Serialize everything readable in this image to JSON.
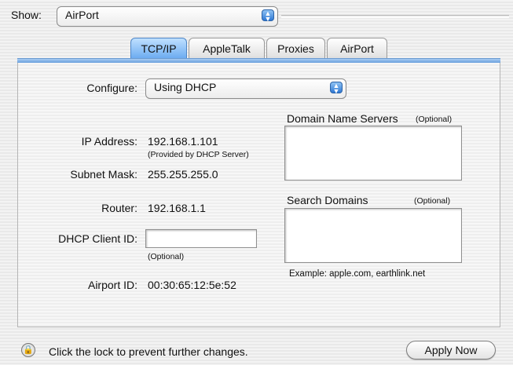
{
  "show": {
    "label": "Show:",
    "value": "AirPort"
  },
  "tabs": [
    {
      "label": "TCP/IP",
      "selected": true
    },
    {
      "label": "AppleTalk",
      "selected": false
    },
    {
      "label": "Proxies",
      "selected": false
    },
    {
      "label": "AirPort",
      "selected": false
    }
  ],
  "configure": {
    "label": "Configure:",
    "value": "Using DHCP"
  },
  "ip": {
    "label": "IP Address:",
    "value": "192.168.1.101",
    "note": "(Provided by DHCP Server)"
  },
  "subnet": {
    "label": "Subnet Mask:",
    "value": "255.255.255.0"
  },
  "router": {
    "label": "Router:",
    "value": "192.168.1.1"
  },
  "dhcp_client": {
    "label": "DHCP Client ID:",
    "value": "",
    "note": "(Optional)"
  },
  "airport_id": {
    "label": "Airport ID:",
    "value": "00:30:65:12:5e:52"
  },
  "dns": {
    "label": "Domain Name Servers",
    "optional": "(Optional)",
    "value": ""
  },
  "search_domains": {
    "label": "Search Domains",
    "optional": "(Optional)",
    "value": "",
    "example": "Example: apple.com, earthlink.net"
  },
  "footer": {
    "lock_text": "Click the lock to prevent further changes.",
    "apply_label": "Apply Now"
  },
  "icons": {
    "lock": "lock-icon",
    "popup_arrows": "updown-arrows-icon"
  }
}
